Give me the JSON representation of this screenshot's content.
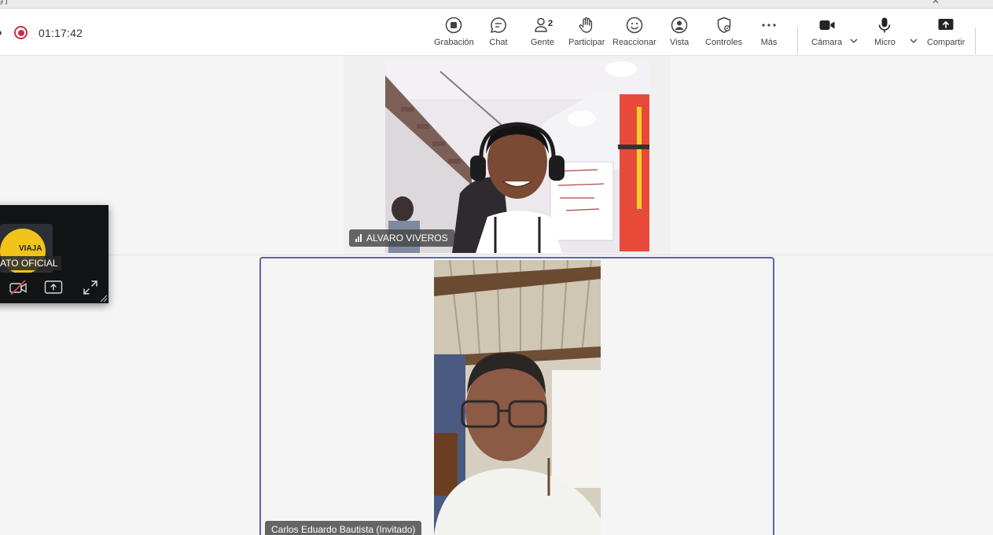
{
  "window": {
    "title_fragment": "g   j",
    "close_glyph": "✕"
  },
  "status": {
    "timer": "01:17:42"
  },
  "toolbar": {
    "recording_label": "Grabación",
    "chat_label": "Chat",
    "people_label": "Gente",
    "people_count": "2",
    "raise_hand_label": "Participar",
    "react_label": "Reaccionar",
    "view_label": "Vista",
    "controls_label": "Controles",
    "more_label": "Más",
    "camera_label": "Cámara",
    "mic_label": "Micro",
    "share_label": "Compartir"
  },
  "participants": [
    {
      "name": "ALVARO VIVEROS"
    },
    {
      "name": "Carlos Eduardo Bautista (Invitado)"
    }
  ],
  "pip": {
    "name": "ATO OFICIAL",
    "logo_text": "VIAJA"
  },
  "colors": {
    "accent": "#6264a7",
    "recording": "#c4314b",
    "logo_yellow": "#f2c318"
  }
}
